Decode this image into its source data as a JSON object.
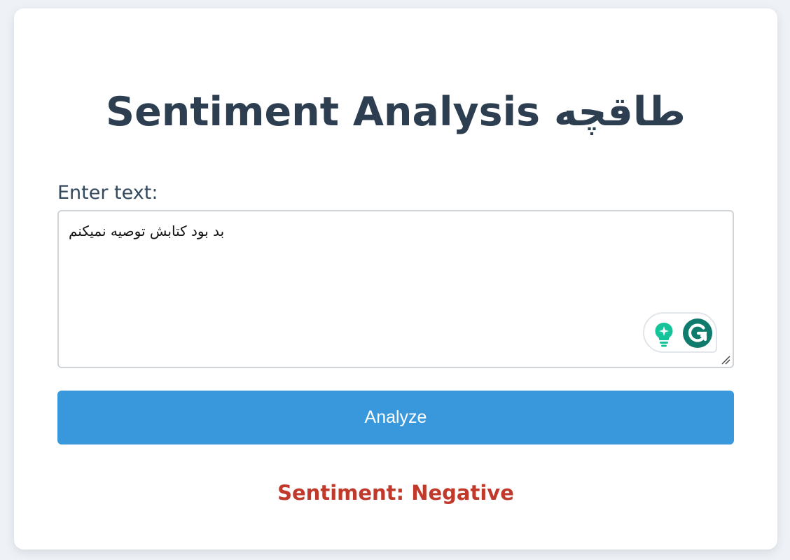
{
  "page": {
    "title": "Sentiment Analysis طاقچه"
  },
  "form": {
    "label": "Enter text:",
    "text_value": "بد بود کتابش توصیه نمیکنم",
    "analyze_label": "Analyze"
  },
  "result": {
    "text": "Sentiment: Negative"
  },
  "colors": {
    "background": "#eef2f7",
    "card": "#ffffff",
    "title": "#2c3e50",
    "button": "#3898db",
    "button_text": "#ffffff",
    "negative": "#c0392b",
    "grammarly_bulb": "#15c39a",
    "grammarly_logo": "#0f7b6c"
  },
  "icons": {
    "assistant": "lightbulb-sparkle-icon",
    "grammarly": "grammarly-logo-icon",
    "resize": "resize-handle-icon"
  }
}
